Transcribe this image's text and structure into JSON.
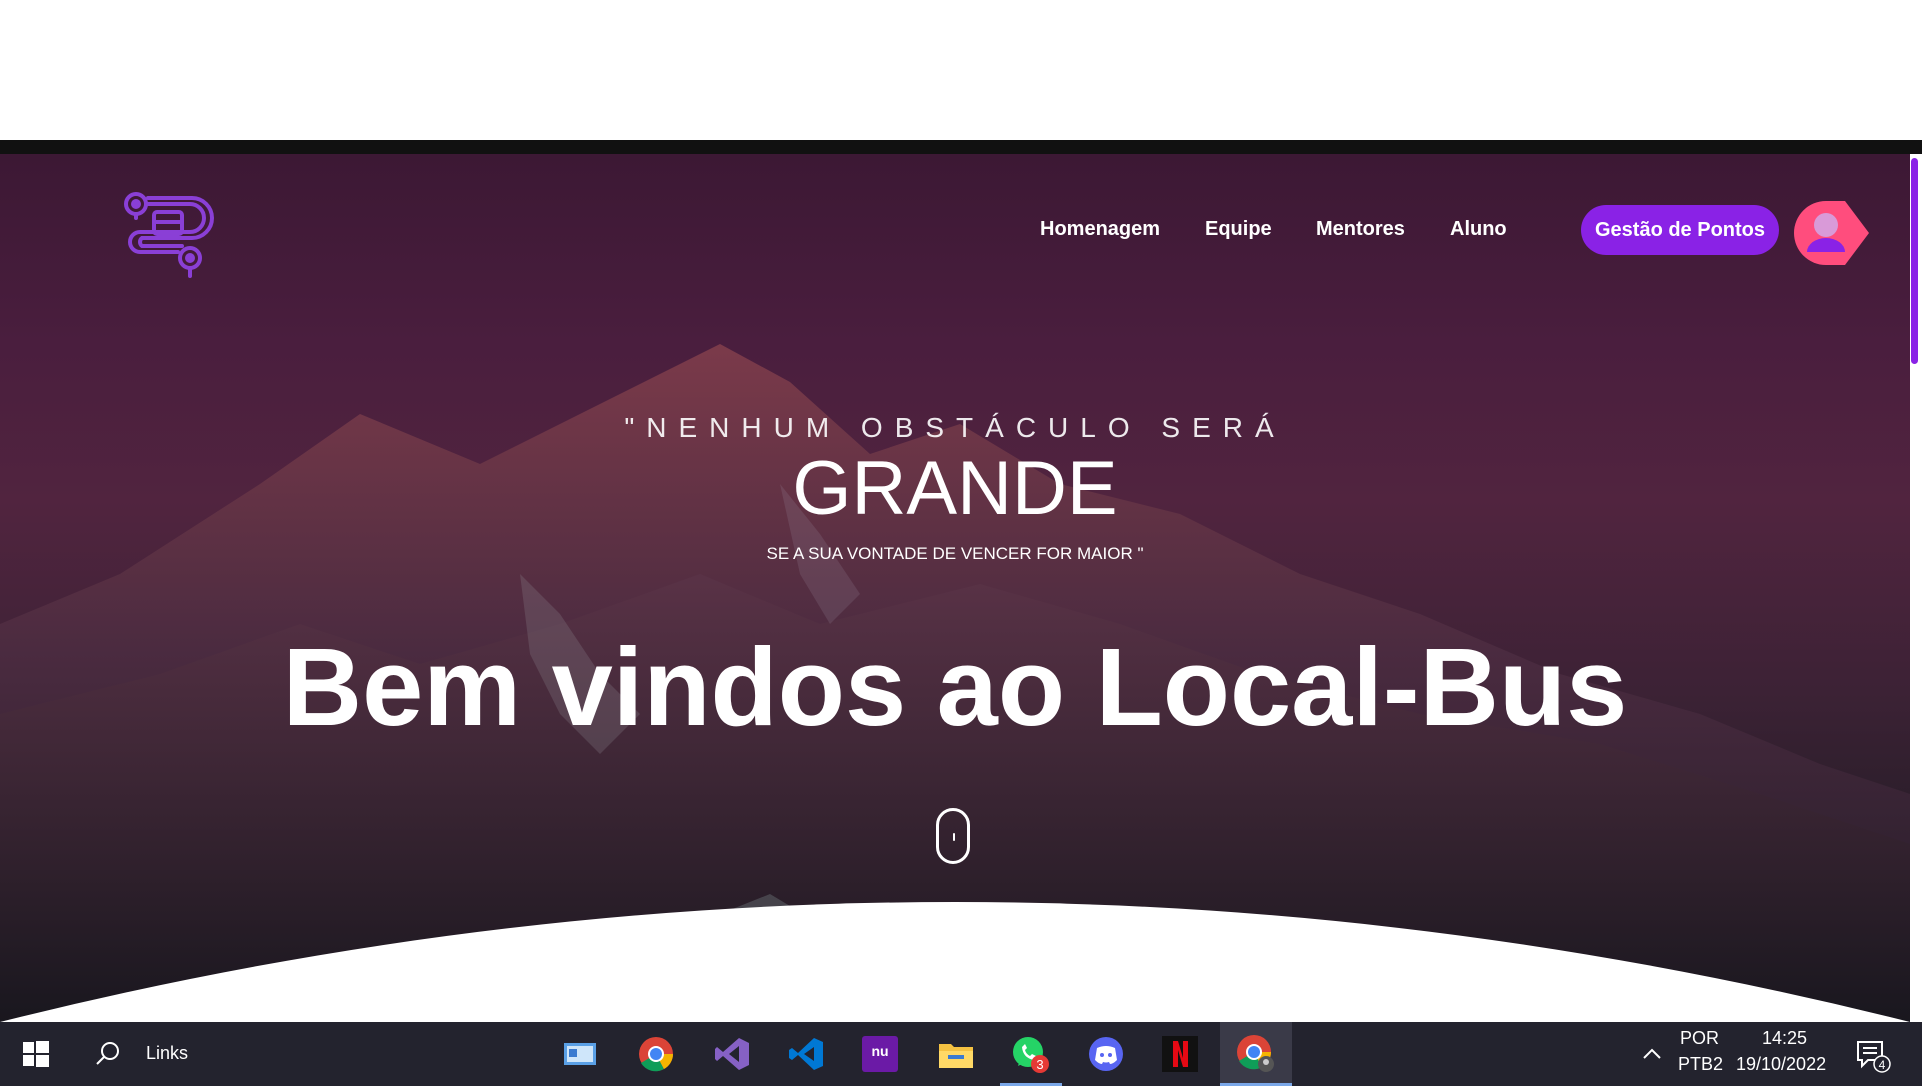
{
  "nav": {
    "links": [
      "Homenagem",
      "Equipe",
      "Mentores",
      "Aluno"
    ],
    "cta_label": "Gestão de Pontos"
  },
  "hero": {
    "quote_top": "\"NENHUM OBSTÁCULO SERÁ",
    "quote_big": "GRANDE",
    "quote_small": "SE A SUA VONTADE DE VENCER FOR MAIOR \"",
    "welcome": "Bem vindos ao Local-Bus"
  },
  "taskbar": {
    "search_label": "Links",
    "whatsapp_badge": "3",
    "lang_top": "POR",
    "lang_bottom": "PTB2",
    "time": "14:25",
    "date": "19/10/2022",
    "notification_count": "4"
  },
  "colors": {
    "accent": "#8a22e6",
    "avatar_bg": "#ff4d7d"
  }
}
